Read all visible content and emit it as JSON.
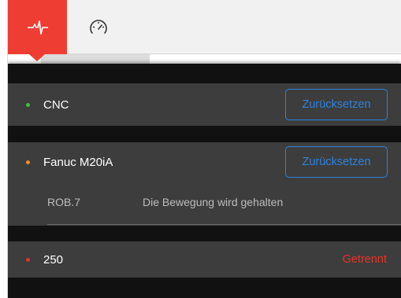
{
  "toolbar": {
    "tabs": [
      {
        "icon": "pulse-icon",
        "active": true,
        "color": "#ee3e34"
      },
      {
        "icon": "gauge-icon",
        "active": false
      }
    ]
  },
  "devices": [
    {
      "name": "CNC",
      "status_color": "#3fbf4a",
      "action_label": "Zurücksetzen"
    },
    {
      "name": "Fanuc M20iA",
      "status_color": "#f28c28",
      "action_label": "Zurücksetzen",
      "detail": {
        "code": "ROB.7",
        "message": "Die Bewegung wird gehalten"
      }
    },
    {
      "name": "250",
      "status_color": "#e5332a",
      "status_text": "Getrennt"
    }
  ],
  "colors": {
    "accent": "#2c82e0",
    "danger": "#e5332a",
    "panel": "#111111",
    "row": "#3d3d3d"
  }
}
